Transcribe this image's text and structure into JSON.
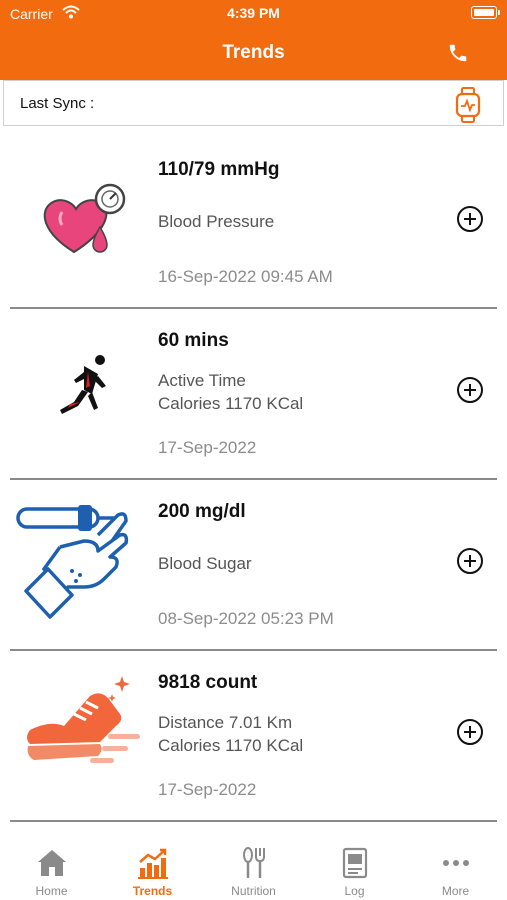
{
  "status_bar": {
    "carrier": "Carrier",
    "time": "4:39 PM"
  },
  "header": {
    "title": "Trends"
  },
  "sync": {
    "label": "Last Sync :"
  },
  "cards": [
    {
      "value": "110/79 mmHg",
      "line1": "Blood Pressure",
      "line2": "",
      "date": "16-Sep-2022 09:45 AM",
      "icon": "heart-pressure-icon"
    },
    {
      "value": "60 mins",
      "line1": "Active Time",
      "line2": "Calories 1170 KCal",
      "date": "17-Sep-2022",
      "icon": "runner-icon"
    },
    {
      "value": "200 mg/dl",
      "line1": "Blood Sugar",
      "line2": "",
      "date": "08-Sep-2022 05:23 PM",
      "icon": "blood-test-icon"
    },
    {
      "value": "9818 count",
      "line1": "Distance 7.01 Km",
      "line2": "Calories 1170 KCal",
      "date": "17-Sep-2022",
      "icon": "shoe-icon"
    }
  ],
  "tabs": [
    {
      "label": "Home",
      "icon": "home-icon",
      "active": false
    },
    {
      "label": "Trends",
      "icon": "trends-chart-icon",
      "active": true
    },
    {
      "label": "Nutrition",
      "icon": "fork-spoon-icon",
      "active": false
    },
    {
      "label": "Log",
      "icon": "log-book-icon",
      "active": false
    },
    {
      "label": "More",
      "icon": "more-dots-icon",
      "active": false
    }
  ],
  "colors": {
    "accent": "#f26b0f",
    "inactive": "#8a8a8a"
  }
}
